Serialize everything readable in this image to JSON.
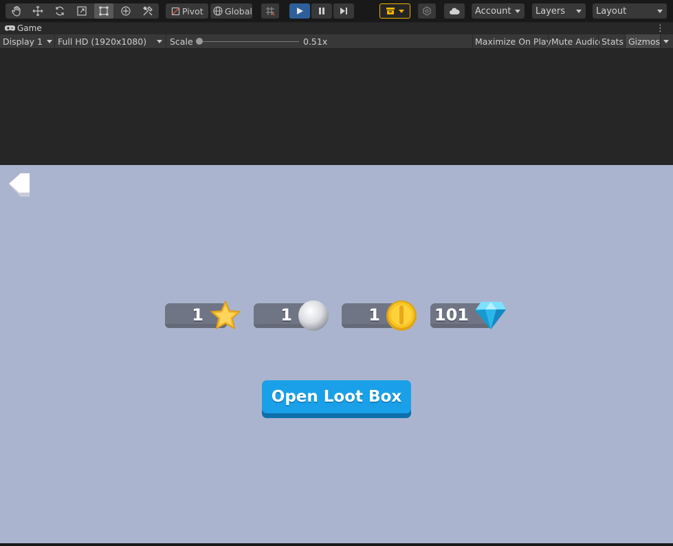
{
  "toolbar": {
    "pivot_label": "Pivot",
    "global_label": "Global",
    "account_label": "Account",
    "layers_label": "Layers",
    "layout_label": "Layout",
    "icons": [
      "hand-icon",
      "move-icon",
      "rotate-icon",
      "scale-icon",
      "rect-tool-icon",
      "transform-icon",
      "custom-tools-icon",
      "grid-snap-icon",
      "play-icon",
      "pause-icon",
      "step-icon",
      "collab-icon",
      "services-icon",
      "cloud-icon"
    ],
    "accent_color": "#f0b400"
  },
  "tab": {
    "title": "Game"
  },
  "controls": {
    "display": "Display 1",
    "resolution": "Full HD (1920x1080)",
    "scale_label": "Scale",
    "scale_value": "0.51x",
    "maximize_on_play": "Maximize On Play",
    "mute_audio": "Mute Audio",
    "stats": "Stats",
    "gizmos": "Gizmos"
  },
  "game": {
    "background": "#abb4cf",
    "currencies": [
      {
        "name": "star",
        "amount": "1"
      },
      {
        "name": "pearl",
        "amount": "1"
      },
      {
        "name": "coin",
        "amount": "1"
      },
      {
        "name": "gem",
        "amount": "101"
      }
    ],
    "open_button_label": "Open Loot Box",
    "button_color": "#1aa0e8"
  }
}
